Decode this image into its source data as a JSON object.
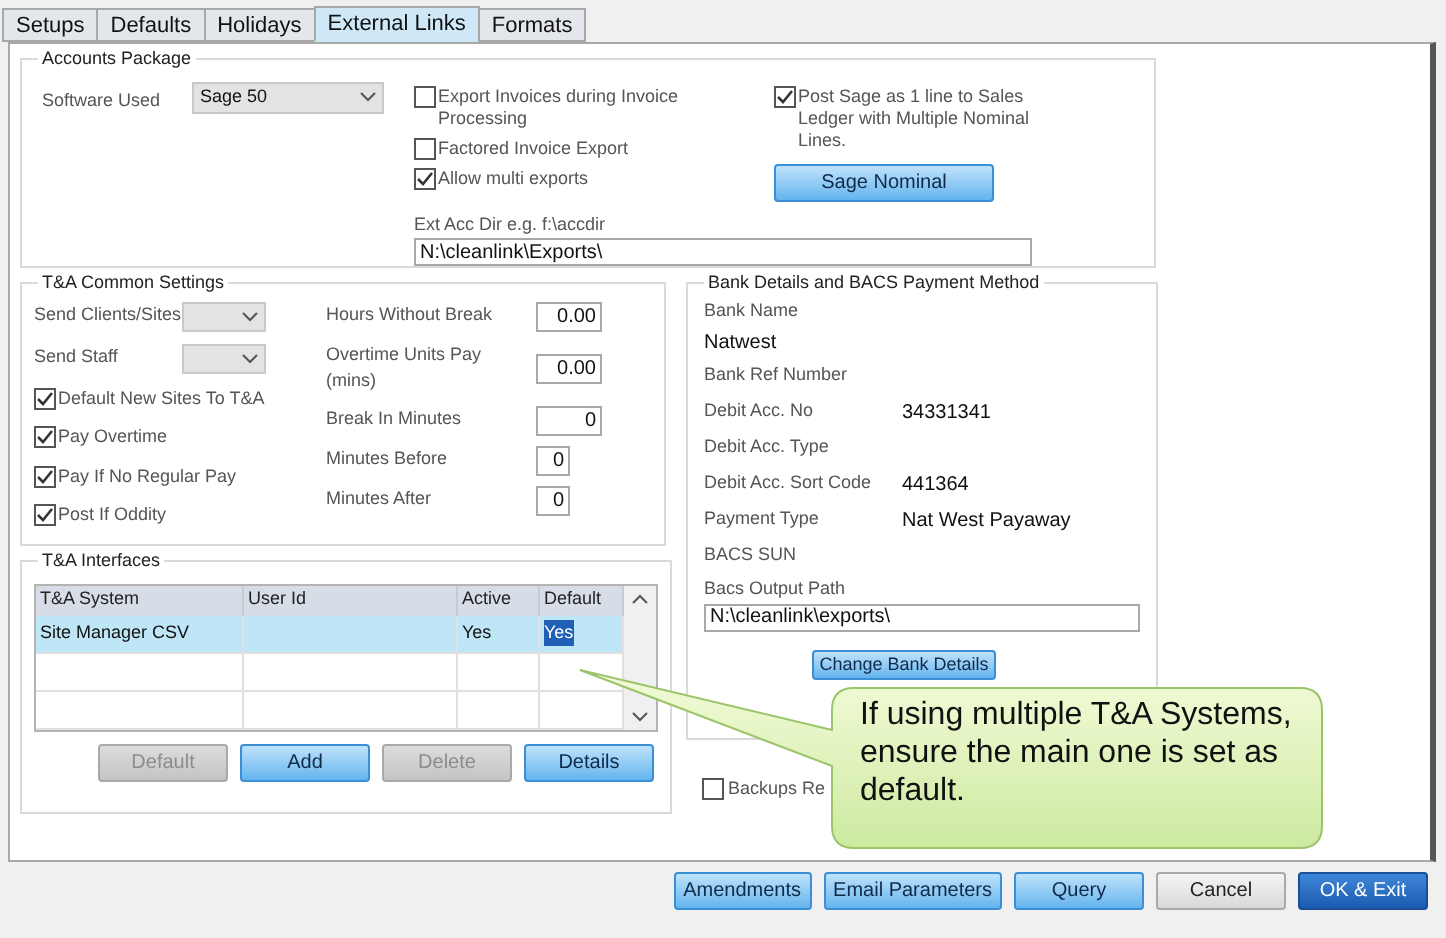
{
  "tabs": [
    {
      "label": "Setups",
      "selected": false
    },
    {
      "label": "Defaults",
      "selected": false
    },
    {
      "label": "Holidays",
      "selected": false
    },
    {
      "label": "External Links",
      "selected": true
    },
    {
      "label": "Formats",
      "selected": false
    }
  ],
  "accounts_package": {
    "title": "Accounts Package",
    "software_used": {
      "label": "Software Used",
      "value": "Sage 50"
    },
    "checkboxes": [
      {
        "label": "Export Invoices during Invoice Processing",
        "checked": false
      },
      {
        "label": "Factored Invoice Export",
        "checked": false
      },
      {
        "label": "Allow multi exports",
        "checked": true
      }
    ],
    "post_sage": {
      "label": "Post Sage as 1 line to Sales Ledger with Multiple Nominal Lines.",
      "checked": true
    },
    "sage_nominal_button": "Sage Nominal",
    "ext_acc_dir": {
      "label": "Ext Acc Dir e.g. f:\\accdir",
      "value": "N:\\cleanlink\\Exports\\"
    }
  },
  "common_settings": {
    "title": "T&A Common Settings",
    "dropdowns": [
      {
        "label": "Send Clients/Sites"
      },
      {
        "label": "Send Staff"
      }
    ],
    "checkboxes": [
      {
        "label": "Default New Sites To T&A",
        "checked": true
      },
      {
        "label": "Pay Overtime",
        "checked": true
      },
      {
        "label": "Pay If No Regular Pay",
        "checked": true
      },
      {
        "label": "Post If Oddity",
        "checked": true
      }
    ],
    "fields": [
      {
        "label": "Hours Without Break",
        "value": "0.00",
        "kind": "wide"
      },
      {
        "label": "Overtime Units Pay (mins)",
        "value": "0.00",
        "kind": "wide"
      },
      {
        "label": "Break In Minutes",
        "value": "0",
        "kind": "wide"
      },
      {
        "label": "Minutes Before",
        "value": "0",
        "kind": "narrow"
      },
      {
        "label": "Minutes After",
        "value": "0",
        "kind": "narrow"
      }
    ]
  },
  "interfaces": {
    "title": "T&A Interfaces",
    "table": {
      "columns": [
        "T&A System",
        "User Id",
        "Active",
        "Default"
      ],
      "rows": [
        {
          "selected": true,
          "default_text_selected": true,
          "cells": [
            "Site Manager CSV",
            "",
            "Yes",
            "Yes"
          ]
        },
        {
          "selected": false,
          "default_text_selected": false
        },
        {
          "selected": false,
          "default_text_selected": false
        }
      ]
    },
    "buttons": [
      {
        "label": "Default",
        "disabled": true
      },
      {
        "label": "Add",
        "disabled": false
      },
      {
        "label": "Delete",
        "disabled": true
      },
      {
        "label": "Details",
        "disabled": false
      }
    ]
  },
  "bank_details": {
    "title": "Bank Details and BACS Payment Method",
    "bank_name": {
      "label": "Bank Name",
      "value": "Natwest"
    },
    "rows": [
      {
        "label": "Bank Ref Number"
      },
      {
        "label": "Debit Acc. No",
        "value": "34331341"
      },
      {
        "label": "Debit Acc. Type"
      },
      {
        "label": "Debit Acc. Sort Code",
        "value": "441364"
      },
      {
        "label": "Payment Type",
        "value": "Nat West Payaway"
      },
      {
        "label": "BACS SUN"
      }
    ],
    "output_path": {
      "label": "Bacs Output Path",
      "value": "N:\\cleanlink\\exports\\"
    },
    "button": "Change Bank Details"
  },
  "backups": {
    "label": "Backups Re",
    "checked": false
  },
  "callout": {
    "text": "If using multiple T&A Systems, ensure the main one is set as default."
  },
  "footer_buttons": [
    {
      "label": "Amendments",
      "kind": "blue"
    },
    {
      "label": "Email Parameters",
      "kind": "blue"
    },
    {
      "label": "Query",
      "kind": "blue"
    },
    {
      "label": "Cancel",
      "kind": "plain"
    },
    {
      "label": "OK & Exit",
      "kind": "primary"
    }
  ]
}
